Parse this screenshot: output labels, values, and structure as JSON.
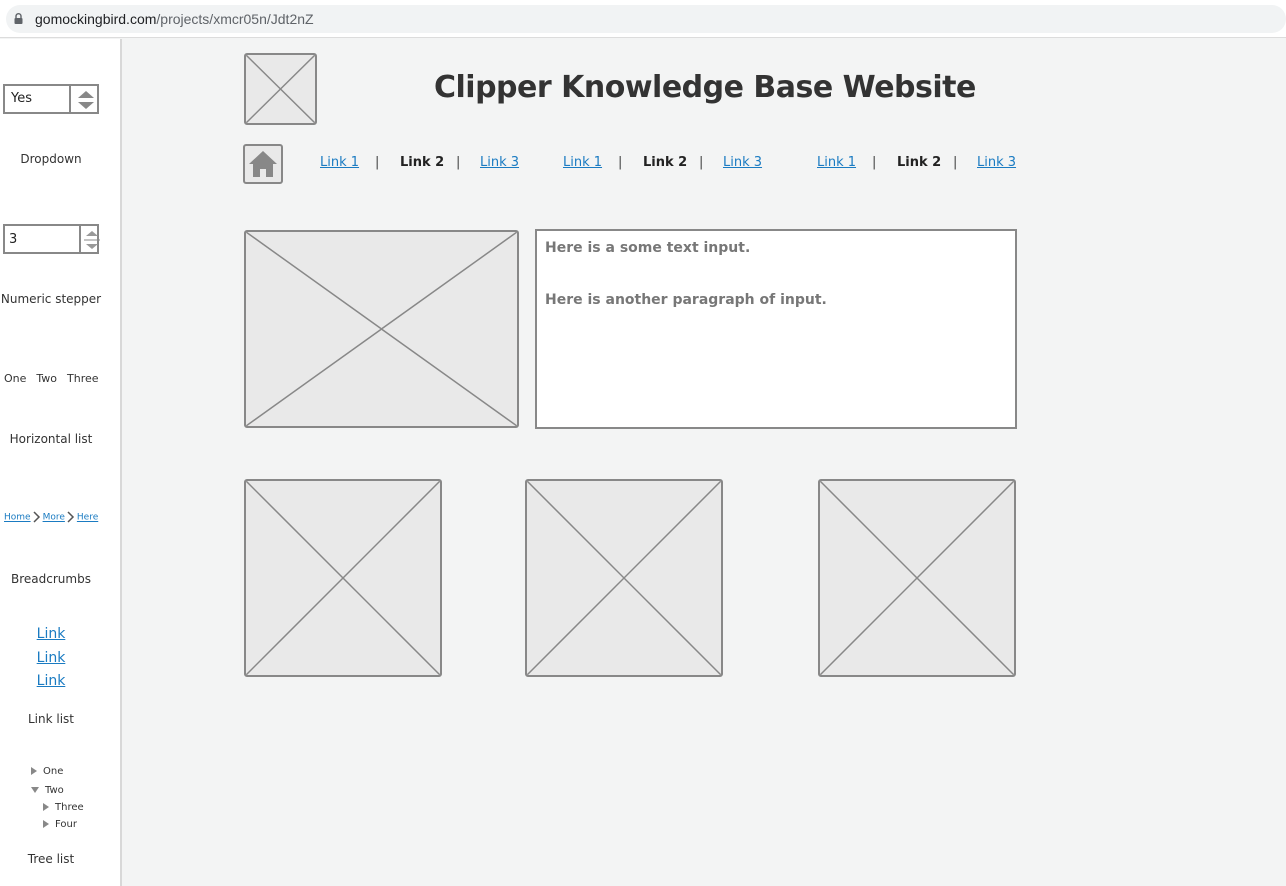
{
  "browser": {
    "url_host": "gomockingbird.com",
    "url_path": "/projects/xmcr05n/Jdt2nZ"
  },
  "sidebar": {
    "dropdown": {
      "value": "Yes",
      "caption": "Dropdown"
    },
    "stepper": {
      "value": "3",
      "caption": "Numeric stepper"
    },
    "horizontal_list": {
      "items": [
        "One",
        "Two",
        "Three"
      ],
      "caption": "Horizontal list"
    },
    "breadcrumbs": {
      "items": [
        "Home",
        "More",
        "Here"
      ],
      "caption": "Breadcrumbs"
    },
    "link_list": {
      "items": [
        "Link",
        "Link",
        "Link"
      ],
      "caption": "Link list"
    },
    "tree_list": {
      "items": [
        {
          "label": "One",
          "expanded": false
        },
        {
          "label": "Two",
          "expanded": true
        },
        {
          "label": "Three",
          "expanded": false
        },
        {
          "label": "Four",
          "expanded": false
        }
      ],
      "caption": "Tree list"
    }
  },
  "main": {
    "title": "Clipper Knowledge Base Website",
    "nav": [
      {
        "label": "Link 1",
        "style": "link"
      },
      {
        "label": "Link 2",
        "style": "plain"
      },
      {
        "label": "Link 3",
        "style": "link"
      },
      {
        "label": "Link 1",
        "style": "link"
      },
      {
        "label": "Link 2",
        "style": "plain"
      },
      {
        "label": "Link 3",
        "style": "link"
      },
      {
        "label": "Link 1",
        "style": "link"
      },
      {
        "label": "Link 2",
        "style": "plain"
      },
      {
        "label": "Link 3",
        "style": "link"
      }
    ],
    "nav_separator": "|",
    "text_input": {
      "paragraphs": [
        "Here is a some text input.",
        "Here is another paragraph of input."
      ]
    }
  },
  "colors": {
    "link": "#1a7bc2",
    "placeholder_fill": "#e9e9e9",
    "placeholder_border": "#888888",
    "canvas": "#f3f4f4"
  }
}
